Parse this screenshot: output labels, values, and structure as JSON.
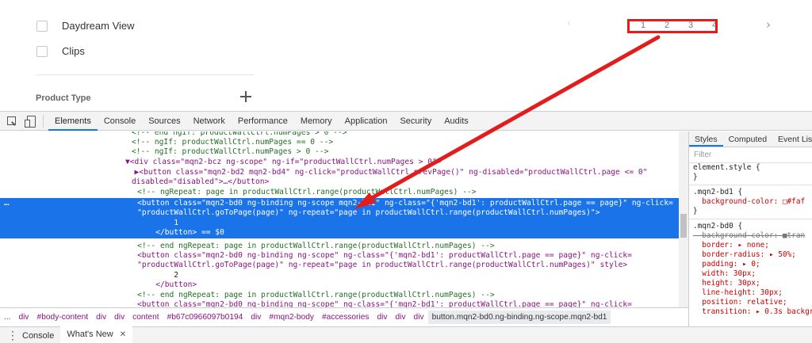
{
  "filters": {
    "items": [
      {
        "label": "Daydream View"
      },
      {
        "label": "Clips"
      }
    ],
    "section_title": "Product Type"
  },
  "pagination": {
    "pages": [
      "1",
      "2",
      "3",
      "4"
    ],
    "prev_icon": "chevron-left-icon",
    "next_icon": "chevron-right-icon",
    "highlight_color": "#e21d1d"
  },
  "devtools": {
    "tabs": [
      "Elements",
      "Console",
      "Sources",
      "Network",
      "Performance",
      "Memory",
      "Application",
      "Security",
      "Audits"
    ],
    "active_tab": "Elements",
    "dom_lines": [
      {
        "kind": "comment",
        "text": "<!-- end ngIf: productWallCtrl.numPages > 0 -->"
      },
      {
        "kind": "comment",
        "text": "<!-- ngIf: productWallCtrl.numPages == 0 -->"
      },
      {
        "kind": "comment",
        "text": "<!-- ngIf: productWallCtrl.numPages > 0 -->"
      },
      {
        "kind": "code",
        "text": "▼<div class=\"mqn2-bcz ng-scope\" ng-if=\"productWallCtrl.numPages > 0\">"
      },
      {
        "kind": "code",
        "text": "  ▶<button class=\"mqn2-bd2 mqn2-bd4\" ng-click=\"productWallCtrl.prevPage()\" ng-disabled=\"productWallCtrl.page <= 0\""
      },
      {
        "kind": "code",
        "text": "disabled=\"disabled\">…</button>"
      },
      {
        "kind": "comment",
        "text": "    <!-- ngRepeat: page in productWallCtrl.range(productWallCtrl.numPages) -->"
      }
    ],
    "selected_lines": [
      "    <button class=\"mqn2-bd0 ng-binding ng-scope mqn2-bd1\" ng-class=\"{'mqn2-bd1': productWallCtrl.page == page}\" ng-click=",
      "    \"productWallCtrl.goToPage(page)\" ng-repeat=\"page in productWallCtrl.range(productWallCtrl.numPages)\">",
      "            1",
      "        </button> == $0"
    ],
    "after_lines": [
      {
        "kind": "comment",
        "text": "    <!-- end ngRepeat: page in productWallCtrl.range(productWallCtrl.numPages) -->"
      },
      {
        "kind": "code",
        "text": "    <button class=\"mqn2-bd0 ng-binding ng-scope\" ng-class=\"{'mqn2-bd1': productWallCtrl.page == page}\" ng-click="
      },
      {
        "kind": "code",
        "text": "    \"productWallCtrl.goToPage(page)\" ng-repeat=\"page in productWallCtrl.range(productWallCtrl.numPages)\" style>"
      },
      {
        "kind": "text",
        "text": "            2"
      },
      {
        "kind": "code",
        "text": "        </button>"
      },
      {
        "kind": "comment",
        "text": "    <!-- end ngRepeat: page in productWallCtrl.range(productWallCtrl.numPages) -->"
      },
      {
        "kind": "code",
        "text": "    <button class=\"mqn2-bd0 ng-binding ng-scope\" ng-class=\"{'mqn2-bd1': productWallCtrl.page == page}\" ng-click="
      }
    ],
    "styles_tabs": [
      "Styles",
      "Computed",
      "Event Lis"
    ],
    "styles_filter": "Filter",
    "styles": [
      "element.style {",
      "}",
      "---",
      ".mqn2-bd1 {",
      "  background-color: □#faf",
      "}",
      "---",
      ".mqn2-bd0 {",
      "  background-color: ■tran",
      "  border: ▸ none;",
      "  border-radius: ▸ 50%;",
      "  padding: ▸ 0;",
      "  width: 30px;",
      "  height: 30px;",
      "  line-height: 30px;",
      "  position: relative;",
      "  transition: ▸ 0.3s backgr"
    ],
    "breadcrumbs": [
      "...",
      "div",
      "#body-content",
      "div",
      "div",
      "content",
      "#b67c0966097b0194",
      "div",
      "#mqn2-body",
      "#accessories",
      "div",
      "div",
      "div",
      "button.mqn2-bd0.ng-binding.ng-scope.mqn2-bd1"
    ],
    "drawer_tabs": [
      "Console",
      "What's New"
    ],
    "accent": "#1a73e8"
  }
}
